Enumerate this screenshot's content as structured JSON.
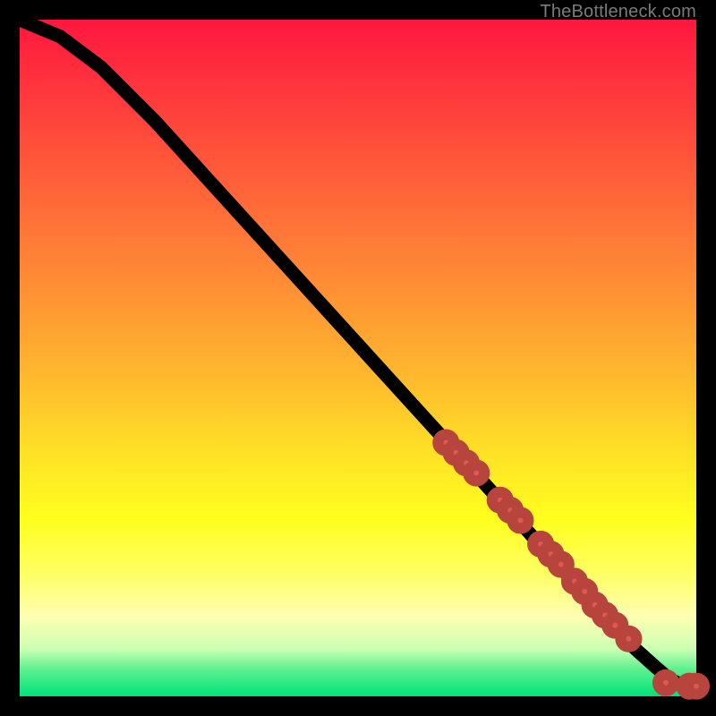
{
  "attribution": "TheBottleneck.com",
  "colors": {
    "marker_fill": "#e0594f",
    "marker_stroke": "#b8453d",
    "curve": "#000000",
    "gradient_top": "#ff173e",
    "gradient_bottom": "#00e27a"
  },
  "chart_data": {
    "type": "line",
    "title": "",
    "xlabel": "",
    "ylabel": "",
    "xlim": [
      0,
      100
    ],
    "ylim": [
      0,
      100
    ],
    "curve": {
      "x": [
        0,
        6,
        12,
        20,
        30,
        40,
        50,
        60,
        65,
        70,
        75,
        80,
        85,
        88,
        91,
        94,
        96,
        98,
        100
      ],
      "y": [
        100,
        97.5,
        93,
        85,
        74,
        63,
        52,
        41,
        35.5,
        30,
        24.5,
        19,
        13.5,
        10,
        7,
        4.3,
        2.6,
        1.6,
        1.5
      ]
    },
    "series": [
      {
        "name": "points",
        "x": [
          63,
          64.5,
          66,
          67.5,
          71,
          72.5,
          74,
          77,
          78.5,
          80,
          82,
          83.5,
          85,
          86.5,
          88,
          90,
          95.5,
          99,
          100
        ],
        "y": [
          37.5,
          36,
          34.5,
          33,
          29,
          27.5,
          26,
          22.5,
          21,
          19.5,
          17,
          15.5,
          13.5,
          12,
          10.5,
          8.5,
          2,
          1.5,
          1.5
        ]
      }
    ]
  }
}
